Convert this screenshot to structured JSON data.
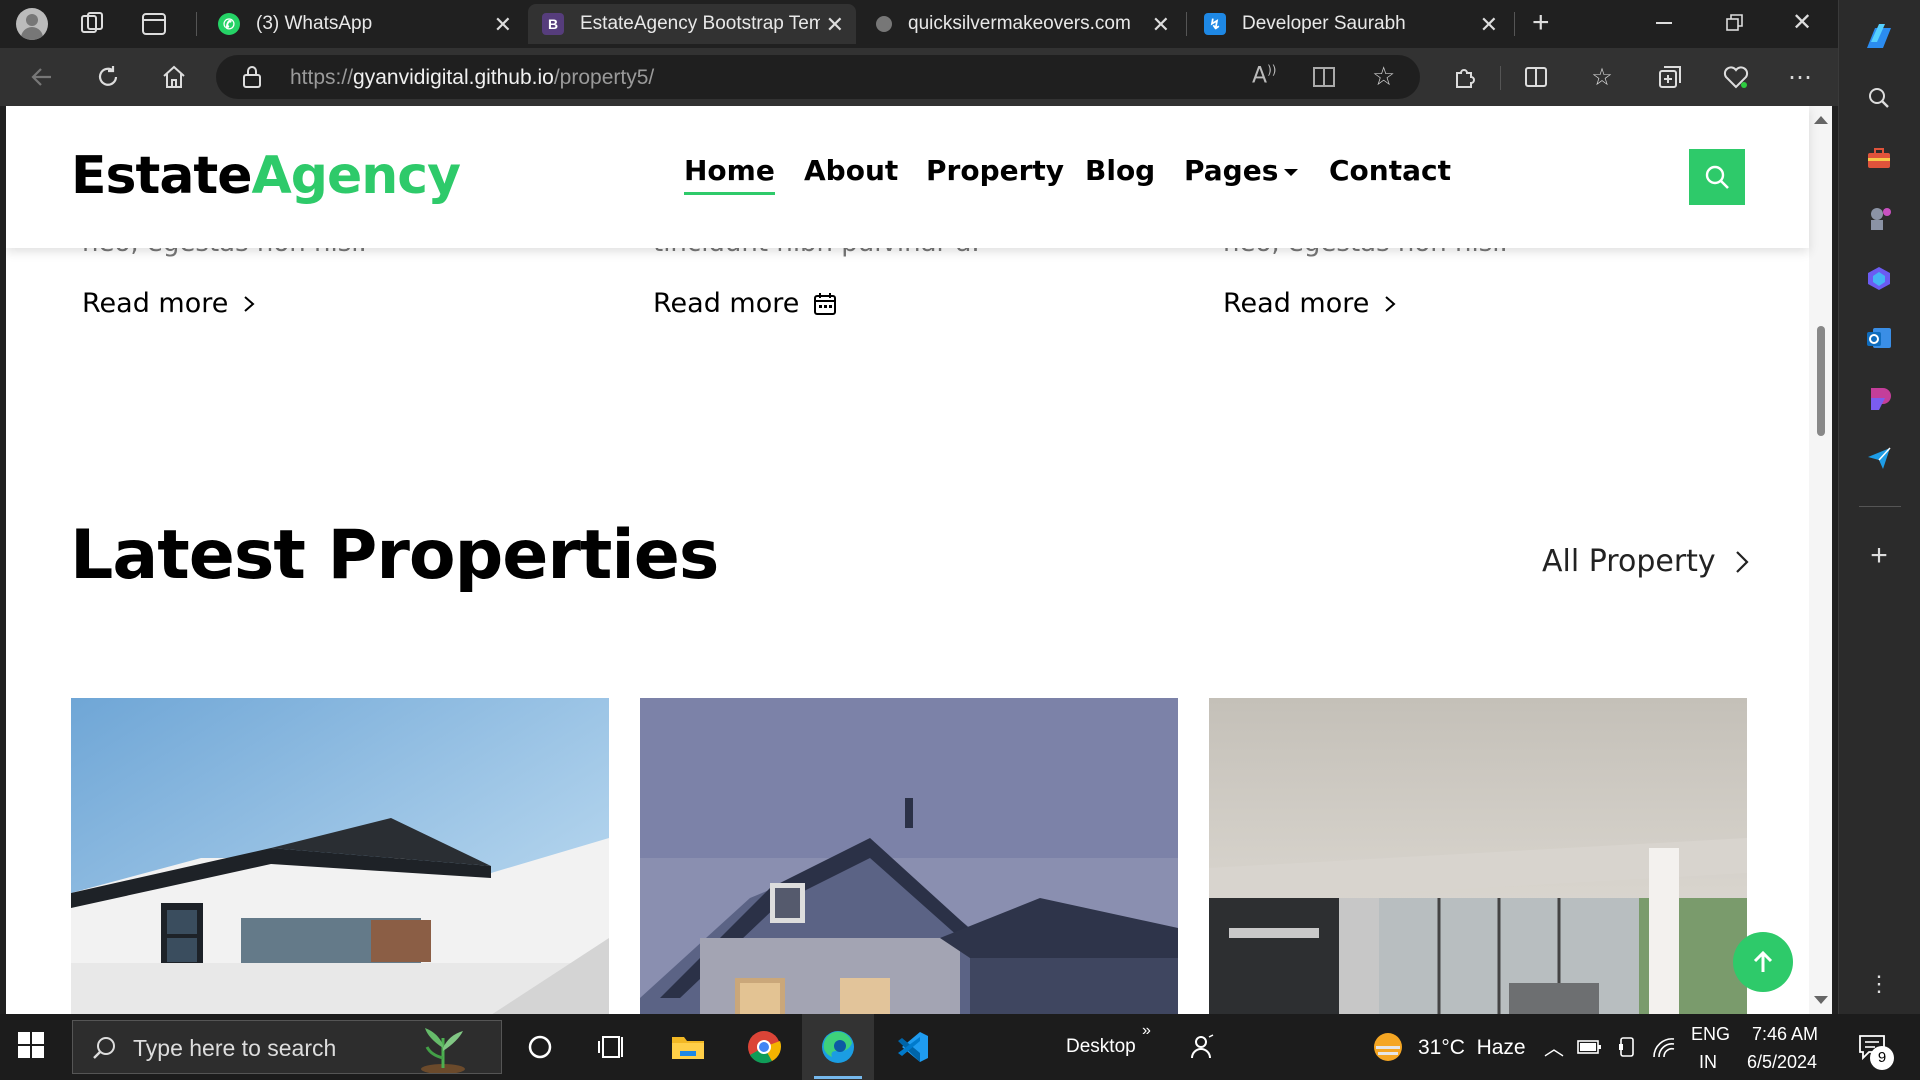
{
  "browser": {
    "tabs": [
      {
        "title": "(3) WhatsApp",
        "active": false
      },
      {
        "title": "EstateAgency Bootstrap Temp",
        "active": true
      },
      {
        "title": "quicksilvermakeovers.com",
        "active": false
      },
      {
        "title": "Developer Saurabh",
        "active": false
      }
    ],
    "url_prefix": "https://",
    "url_domain": "gyanvidigital.github.io",
    "url_path": "/property5/"
  },
  "site": {
    "logo_part1": "Estate",
    "logo_part2": "Agency",
    "nav": [
      "Home",
      "About",
      "Property",
      "Blog",
      "Pages",
      "Contact"
    ],
    "accent_color": "#2eca6a"
  },
  "cards_above": {
    "snippets": [
      "neo, egestas non nisi.",
      "tincidunt nibh pulvinar a.",
      "neo, egestas non nisi."
    ],
    "read_more": "Read more"
  },
  "latest": {
    "title": "Latest Properties",
    "all_link": "All Property"
  },
  "taskbar": {
    "search_placeholder": "Type here to search",
    "desktop_label": "Desktop",
    "weather": "31°C  Haze",
    "lang_top": "ENG",
    "lang_bottom": "IN",
    "time": "7:46 AM",
    "date": "6/5/2024",
    "notification_count": "9"
  }
}
